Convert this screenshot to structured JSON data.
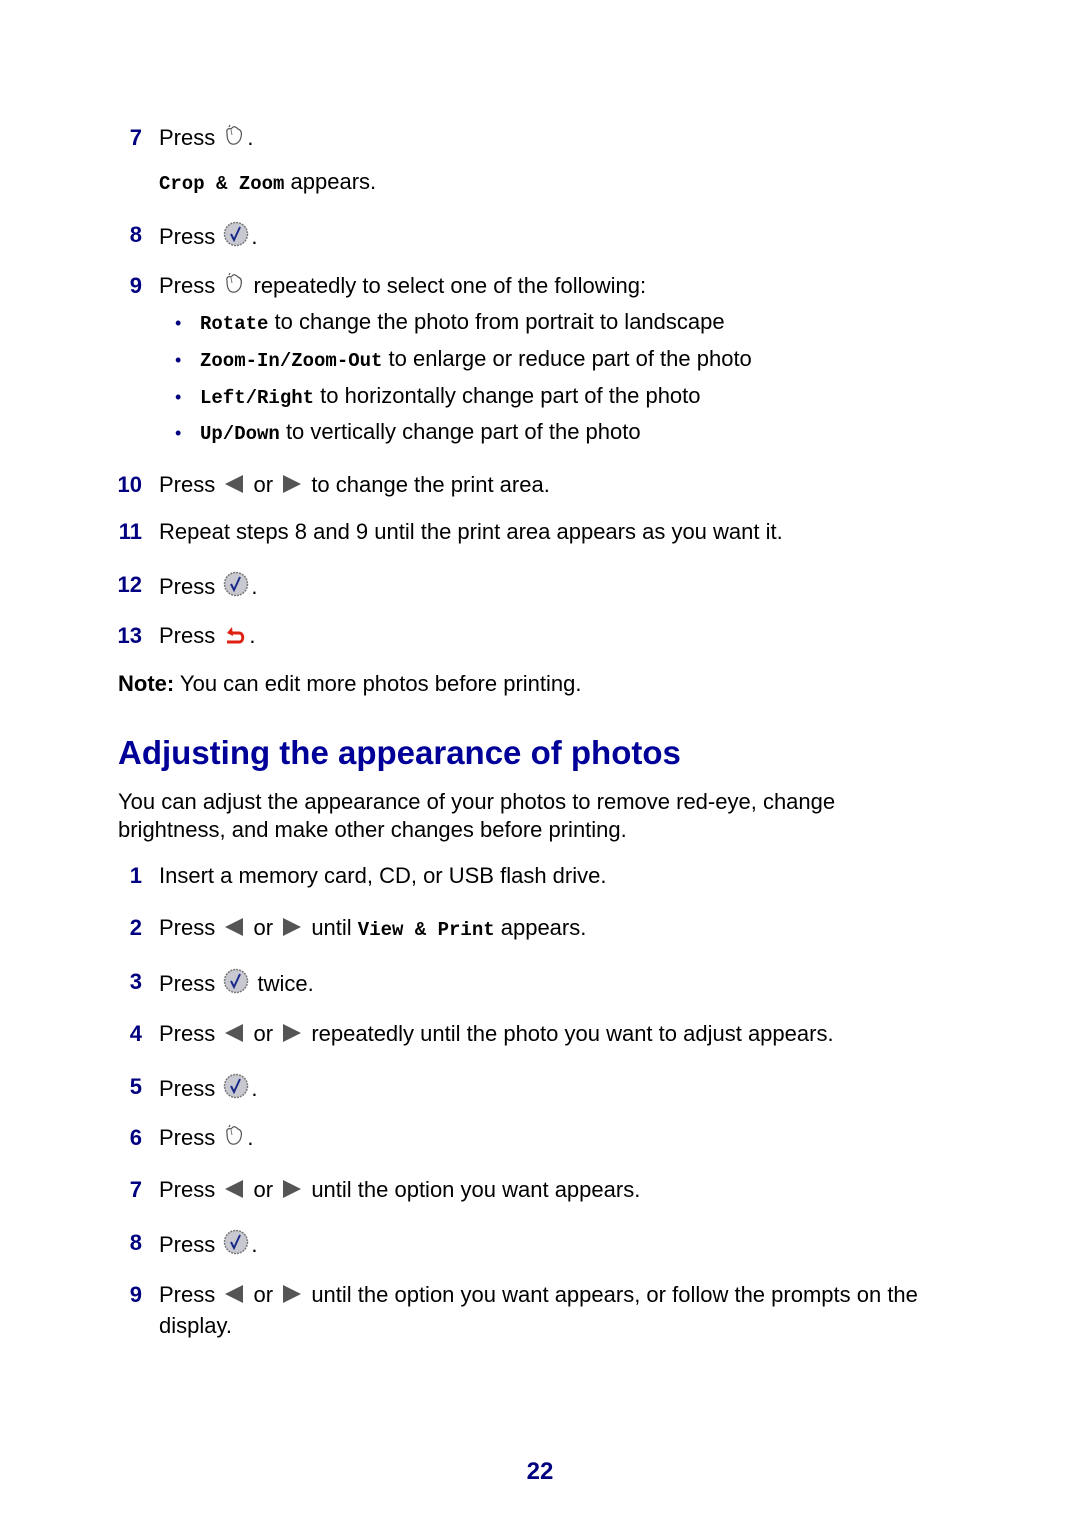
{
  "document": {
    "page_number": "22",
    "heading": "Adjusting the appearance of photos",
    "intro": "You can adjust the appearance of your photos to remove red-eye, change brightness, and make other changes before printing.",
    "colors": {
      "heading": "#000099",
      "step_number": "#000080",
      "back_icon": "#dd2211"
    },
    "first_procedure": {
      "steps": [
        {
          "num": "7",
          "pre": "Press",
          "icon": "select-hand-icon",
          "post": "."
        },
        {
          "sub_mono": "Crop & Zoom",
          "sub_text": " appears."
        },
        {
          "num": "8",
          "pre": "Press",
          "icon": "checkmark-button-icon",
          "post": "."
        },
        {
          "num": "9",
          "pre": "Press",
          "icon": "select-hand-icon",
          "post": " repeatedly to select one of the following:"
        },
        {
          "num": "10",
          "pre": "Press",
          "or": "or",
          "post": "to change the print area."
        },
        {
          "num": "11",
          "text": "Repeat steps 8 and 9 until the print area appears as you want it."
        },
        {
          "num": "12",
          "pre": "Press",
          "icon": "checkmark-button-icon",
          "post": "."
        },
        {
          "num": "13",
          "pre": "Press",
          "icon": "back-arrow-icon",
          "post": "."
        }
      ],
      "bullets": [
        {
          "mono": "Rotate",
          "text": " to change the photo from portrait to landscape"
        },
        {
          "mono": "Zoom-In/Zoom-Out",
          "text": " to enlarge or reduce part of the photo"
        },
        {
          "mono": "Left/Right",
          "text": " to horizontally change part of the photo"
        },
        {
          "mono": "Up/Down",
          "text": " to vertically change part of the photo"
        }
      ],
      "note_label": "Note:",
      "note_text": " You can edit more photos before printing."
    },
    "second_procedure": {
      "steps": [
        {
          "num": "1",
          "text": "Insert a memory card, CD, or USB flash drive."
        },
        {
          "num": "2",
          "pre": "Press",
          "or": "or",
          "mid": "until",
          "mono": "View & Print",
          "post": " appears."
        },
        {
          "num": "3",
          "pre": "Press",
          "post": " twice."
        },
        {
          "num": "4",
          "pre": "Press",
          "or": "or",
          "post": "repeatedly until the photo you want to adjust appears."
        },
        {
          "num": "5",
          "pre": "Press",
          "post": "."
        },
        {
          "num": "6",
          "pre": "Press",
          "post": "."
        },
        {
          "num": "7",
          "pre": "Press",
          "or": "or",
          "post": "until the option you want appears."
        },
        {
          "num": "8",
          "pre": "Press",
          "post": "."
        },
        {
          "num": "9",
          "pre": "Press",
          "or": "or",
          "post": "until the option you want appears, or follow the prompts on the display."
        }
      ]
    }
  }
}
